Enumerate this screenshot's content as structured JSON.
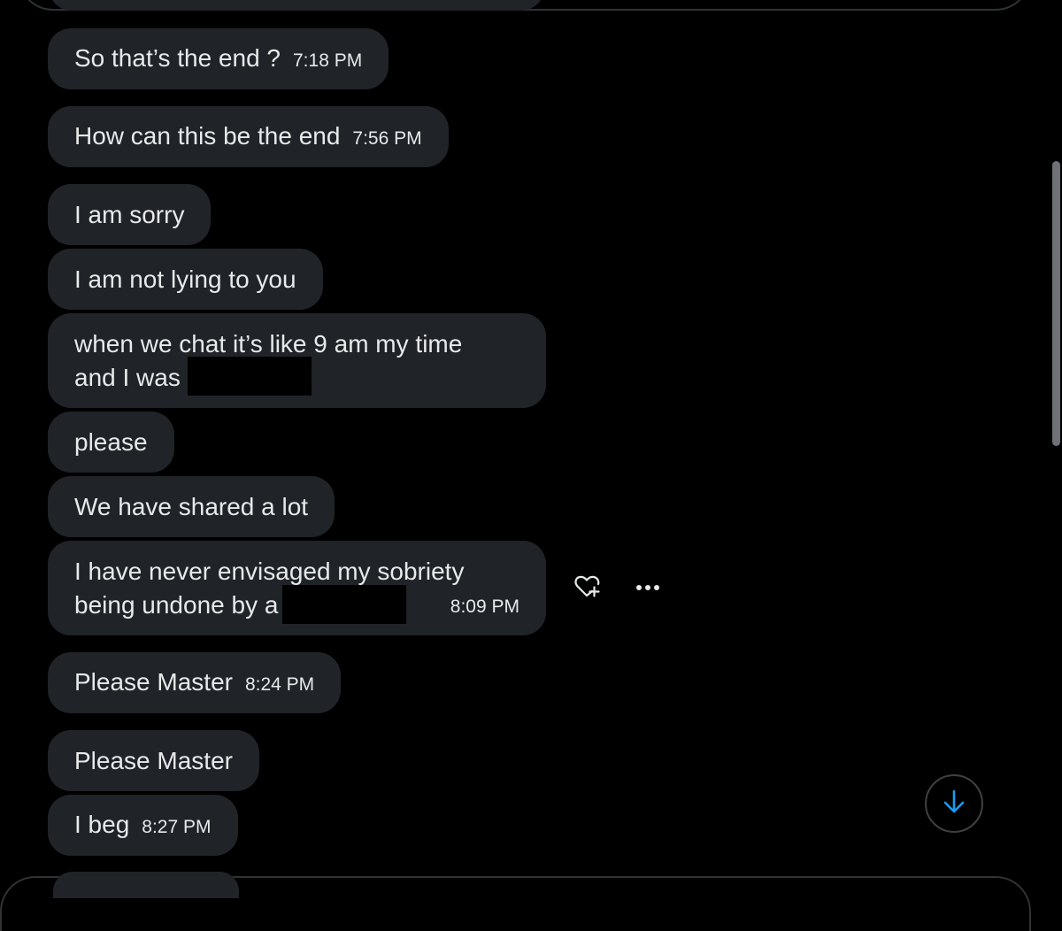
{
  "messages": [
    {
      "text": "So that’s the end ?",
      "time": "7:18 PM"
    },
    {
      "text": "How can this be the end",
      "time": "7:56 PM"
    },
    {
      "text": "I am sorry",
      "time": ""
    },
    {
      "text": "I am not lying to you",
      "time": ""
    },
    {
      "line1": "when we chat it’s like 9 am my time",
      "line2": "and I was",
      "time": ""
    },
    {
      "text": "please",
      "time": ""
    },
    {
      "text": "We have shared a lot",
      "time": ""
    },
    {
      "line1": "I have never envisaged my sobriety",
      "line2": "being undone by a",
      "time": "8:09 PM"
    },
    {
      "text": "Please Master",
      "time": "8:24 PM"
    },
    {
      "text": "Please Master",
      "time": ""
    },
    {
      "text": "I beg",
      "time": "8:27 PM"
    }
  ],
  "actions": {
    "react_icon": "heart-plus-icon",
    "more_icon": "more-horizontal-icon"
  },
  "scroll_down_icon": "arrow-down-icon",
  "colors": {
    "background": "#000000",
    "bubble": "#202327",
    "text": "#e7e9ea",
    "accent": "#1d9bf0"
  }
}
